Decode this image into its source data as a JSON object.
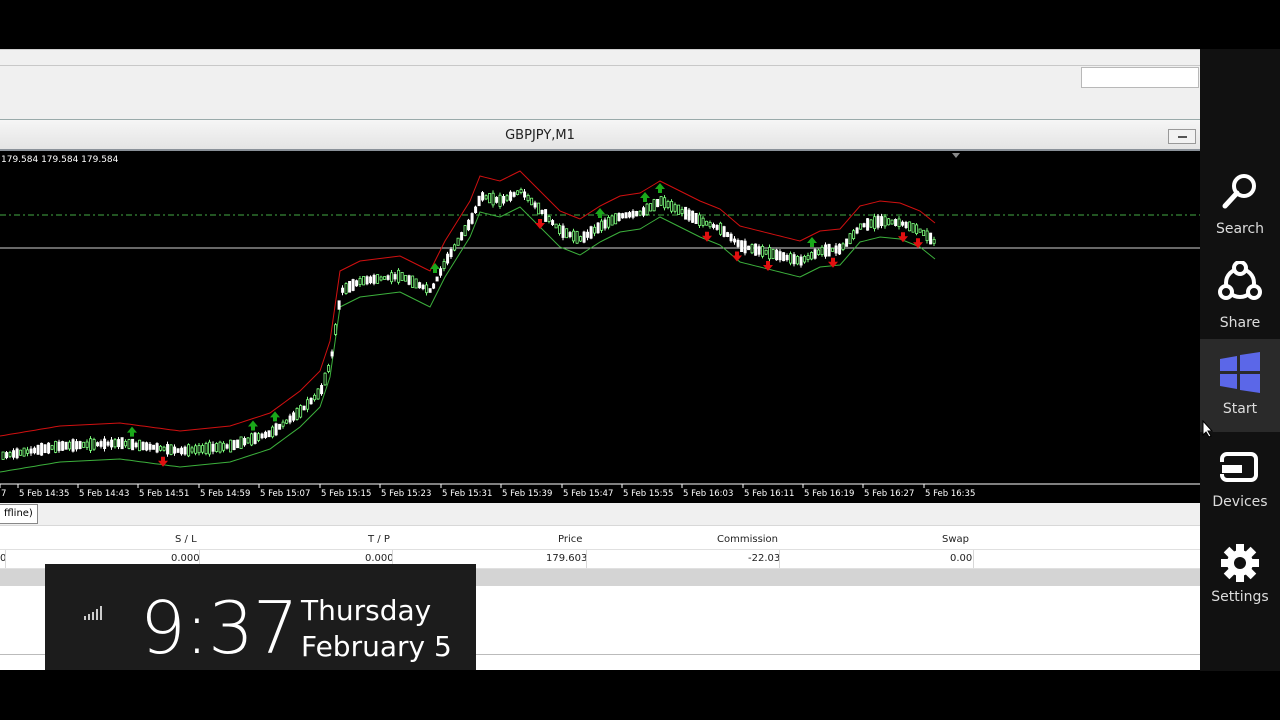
{
  "chart": {
    "title": "GBPJPY,M1",
    "ohlc_readout": "179.584 179.584 179.584",
    "time_labels": [
      "7",
      "5 Feb 14:35",
      "5 Feb 14:43",
      "5 Feb 14:51",
      "5 Feb 14:59",
      "5 Feb 15:07",
      "5 Feb 15:15",
      "5 Feb 15:23",
      "5 Feb 15:31",
      "5 Feb 15:39",
      "5 Feb 15:47",
      "5 Feb 15:55",
      "5 Feb 16:03",
      "5 Feb 16:11",
      "5 Feb 16:19",
      "5 Feb 16:27",
      "5 Feb 16:35"
    ],
    "colors": {
      "bull": "#7cfc7c",
      "bear": "#ffffff",
      "upper_band": "#d01010",
      "lower_band": "#3cb03c",
      "buy_arrow": "#1aa81a",
      "sell_arrow": "#e01010",
      "level_line": "#44aa44"
    }
  },
  "terminal": {
    "tab_label": "ffline)",
    "columns": [
      "S / L",
      "T / P",
      "Price",
      "Commission",
      "Swap"
    ],
    "row": {
      "first": "0",
      "sl": "0.000",
      "tp": "0.000",
      "price": "179.603",
      "commission": "-22.03",
      "swap": "0.00"
    }
  },
  "clock": {
    "time": "9:37",
    "day": "Thursday",
    "date": "February 5"
  },
  "charms": [
    {
      "label": "Search",
      "icon": "search-icon"
    },
    {
      "label": "Share",
      "icon": "share-icon"
    },
    {
      "label": "Start",
      "icon": "windows-icon"
    },
    {
      "label": "Devices",
      "icon": "devices-icon"
    },
    {
      "label": "Settings",
      "icon": "gear-icon"
    }
  ]
}
